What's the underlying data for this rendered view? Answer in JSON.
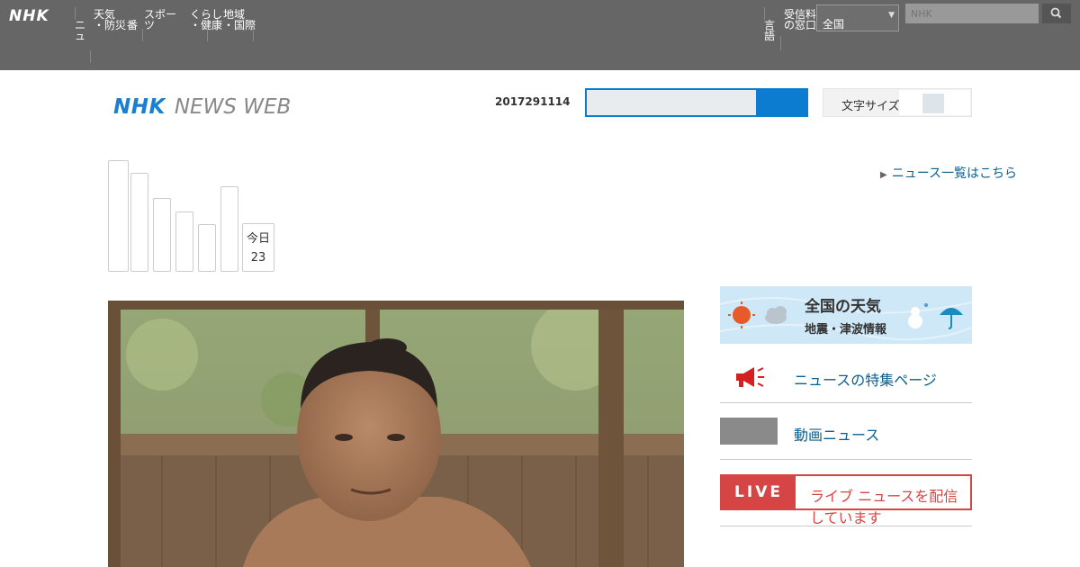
{
  "gnav": {
    "logo": "NHK",
    "items": [
      {
        "label": "ニュ\nース"
      },
      {
        "label": "天気\n・防災"
      },
      {
        "label": "番組"
      },
      {
        "label": "スポー\nツ"
      },
      {
        "label": "くらし\n・健康"
      },
      {
        "label": "地域\n・国際"
      }
    ],
    "right_items": [
      {
        "label": "言語\n設定"
      },
      {
        "label": "受信料\nの窓口"
      }
    ],
    "select_value": "全国",
    "search_placeholder": "NHK"
  },
  "header": {
    "logo_nhk": "NHK",
    "logo_news": "NEWS WEB",
    "date_text": "2017291114",
    "toggle_label": "文字サイズ"
  },
  "week": {
    "box_label": "今日",
    "box_value": "23",
    "bars": [
      {
        "level": 1.0
      },
      {
        "level": 0.89
      },
      {
        "level": 0.66
      },
      {
        "level": 0.54
      },
      {
        "level": 0.43
      },
      {
        "level": 0.77
      }
    ]
  },
  "side_link": "ニュース一覧はこちら",
  "weather_banner": {
    "title": "全国の天気",
    "subtitle": "地震・津波情報"
  },
  "right_links": [
    {
      "label": "ニュースの特集ページ"
    },
    {
      "label": "動画ニュース"
    }
  ],
  "live": {
    "tag": "LIVE",
    "text": "ライブ ニュースを配信しています"
  },
  "colors": {
    "accent": "#0b7cd0",
    "live_red": "#d64545",
    "link": "#0b5f8f",
    "gnav_bg": "#666666"
  }
}
